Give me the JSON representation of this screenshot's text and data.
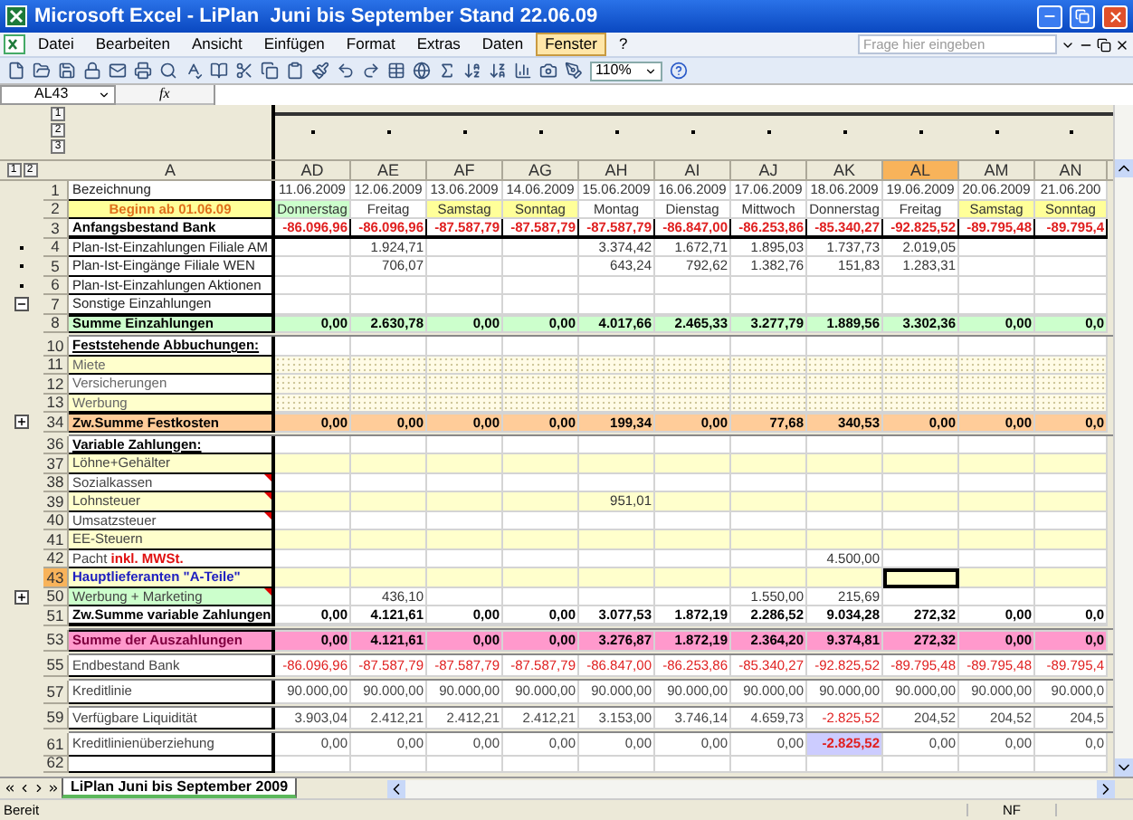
{
  "window": {
    "title": "Microsoft Excel - LiPlan  Juni bis September Stand 22.06.09"
  },
  "menu": [
    {
      "label": "Datei",
      "selected": false
    },
    {
      "label": "Bearbeiten",
      "selected": false
    },
    {
      "label": "Ansicht",
      "selected": false
    },
    {
      "label": "Einfügen",
      "selected": false
    },
    {
      "label": "Format",
      "selected": false
    },
    {
      "label": "Extras",
      "selected": false
    },
    {
      "label": "Daten",
      "selected": false
    },
    {
      "label": "Fenster",
      "selected": true
    },
    {
      "label": "?",
      "selected": false
    }
  ],
  "help_search": {
    "placeholder": "Frage hier eingeben"
  },
  "toolbar": {
    "zoom": "110%"
  },
  "formula_bar": {
    "name_box": "AL43",
    "fx": "fx"
  },
  "outline": {
    "column_levels": [
      "1",
      "2",
      "3"
    ],
    "row_levels": [
      "1",
      "2"
    ]
  },
  "first_column": "A",
  "columns": [
    {
      "letter": "AD",
      "first_day": true,
      "weekend": false,
      "selected": false
    },
    {
      "letter": "AE",
      "first_day": false,
      "weekend": false,
      "selected": false
    },
    {
      "letter": "AF",
      "first_day": false,
      "weekend": true,
      "selected": false
    },
    {
      "letter": "AG",
      "first_day": false,
      "weekend": true,
      "selected": false
    },
    {
      "letter": "AH",
      "first_day": false,
      "weekend": false,
      "selected": false
    },
    {
      "letter": "AI",
      "first_day": false,
      "weekend": false,
      "selected": false
    },
    {
      "letter": "AJ",
      "first_day": false,
      "weekend": false,
      "selected": false
    },
    {
      "letter": "AK",
      "first_day": false,
      "weekend": false,
      "selected": false
    },
    {
      "letter": "AL",
      "first_day": false,
      "weekend": false,
      "selected": true
    },
    {
      "letter": "AM",
      "first_day": false,
      "weekend": true,
      "selected": false
    },
    {
      "letter": "AN",
      "first_day": false,
      "weekend": true,
      "selected": false
    }
  ],
  "rows": [
    {
      "number": "1",
      "kind": "dates",
      "label": "Bezeichnung",
      "selected": false,
      "comment": false,
      "values": [
        "11.06.2009",
        "12.06.2009",
        "13.06.2009",
        "14.06.2009",
        "15.06.2009",
        "16.06.2009",
        "17.06.2009",
        "18.06.2009",
        "19.06.2009",
        "20.06.2009",
        "21.06.200"
      ]
    },
    {
      "number": "2",
      "kind": "days",
      "label": "Beginn ab 01.06.09",
      "selected": false,
      "comment": false,
      "values": [
        "Donnerstag",
        "Freitag",
        "Samstag",
        "Sonntag",
        "Montag",
        "Dienstag",
        "Mittwoch",
        "Donnerstag",
        "Freitag",
        "Samstag",
        "Sonntag"
      ]
    },
    {
      "number": "3",
      "kind": "balance",
      "label": "Anfangsbestand Bank",
      "selected": false,
      "comment": false,
      "values": [
        "-86.096,96",
        "-86.096,96",
        "-87.587,79",
        "-87.587,79",
        "-87.587,79",
        "-86.847,00",
        "-86.253,86",
        "-85.340,27",
        "-92.825,52",
        "-89.795,48",
        "-89.795,4"
      ],
      "negative": [
        true,
        true,
        true,
        true,
        true,
        true,
        true,
        true,
        true,
        true,
        true
      ]
    },
    {
      "number": "4",
      "kind": "entry",
      "outline": {
        "kind": "dot"
      },
      "label": "Plan-Ist-Einzahlungen Filiale AM",
      "selected": false,
      "comment": false,
      "values": {
        "1": "1.924,71",
        "4": "3.374,42",
        "5": "1.672,71",
        "6": "1.895,03",
        "7": "1.737,73",
        "8": "2.019,05"
      }
    },
    {
      "number": "5",
      "kind": "entry",
      "outline": {
        "kind": "dot"
      },
      "label": "Plan-Ist-Eingänge Filiale WEN",
      "selected": false,
      "comment": false,
      "values": {
        "1": "706,07",
        "4": "643,24",
        "5": "792,62",
        "6": "1.382,76",
        "7": "151,83",
        "8": "1.283,31"
      }
    },
    {
      "number": "6",
      "kind": "entry",
      "outline": {
        "kind": "dot"
      },
      "label": "Plan-Ist-Einzahlungen  Aktionen",
      "selected": false,
      "comment": false
    },
    {
      "number": "7",
      "kind": "entry",
      "outline": {
        "kind": "collapse"
      },
      "label": "Sonstige Einzahlungen",
      "selected": false,
      "comment": false
    },
    {
      "number": "8",
      "kind": "sum_green",
      "label": "Summe Einzahlungen",
      "selected": false,
      "comment": false,
      "values": [
        "0,00",
        "2.630,78",
        "0,00",
        "0,00",
        "4.017,66",
        "2.465,33",
        "3.277,79",
        "1.889,56",
        "3.302,36",
        "0,00",
        "0,0"
      ]
    },
    {
      "number": "10",
      "kind": "section",
      "gap_before": true,
      "label": "Feststehende Abbuchungen:",
      "selected": false,
      "comment": false
    },
    {
      "number": "11",
      "kind": "fixed",
      "band": {
        "kind": "yellow"
      },
      "label": "Miete",
      "selected": false,
      "comment": false
    },
    {
      "number": "12",
      "kind": "fixed",
      "band": {
        "kind": "none"
      },
      "label": "Versicherungen",
      "selected": false,
      "comment": false
    },
    {
      "number": "13",
      "kind": "fixed",
      "band": {
        "kind": "yellow"
      },
      "label": "Werbung",
      "selected": false,
      "comment": false
    },
    {
      "number": "34",
      "kind": "sum_orange",
      "outline": {
        "kind": "expand"
      },
      "label": "Zw.Summe Festkosten",
      "selected": false,
      "comment": false,
      "values": [
        "0,00",
        "0,00",
        "0,00",
        "0,00",
        "199,34",
        "0,00",
        "77,68",
        "340,53",
        "0,00",
        "0,00",
        "0,0"
      ]
    },
    {
      "number": "36",
      "kind": "section",
      "gap_before": true,
      "label": "Variable Zahlungen:",
      "selected": false,
      "comment": false
    },
    {
      "number": "37",
      "kind": "variable",
      "band": {
        "kind": "yellow"
      },
      "label": "Löhne+Gehälter",
      "selected": false,
      "comment": false
    },
    {
      "number": "38",
      "kind": "variable",
      "band": {
        "kind": "none"
      },
      "label": "Sozialkassen",
      "selected": false,
      "comment": true
    },
    {
      "number": "39",
      "kind": "variable",
      "band": {
        "kind": "yellow"
      },
      "label": "Lohnsteuer",
      "selected": false,
      "comment": true,
      "values": {
        "4": "951,01"
      }
    },
    {
      "number": "40",
      "kind": "variable",
      "band": {
        "kind": "none"
      },
      "label": "Umsatzsteuer",
      "selected": false,
      "comment": true
    },
    {
      "number": "41",
      "kind": "variable",
      "band": {
        "kind": "yellow"
      },
      "label": "EE-Steuern",
      "selected": false,
      "comment": false
    },
    {
      "number": "42",
      "kind": "variable",
      "band": {
        "kind": "none"
      },
      "label": "Pacht",
      "label_note": "inkl. MWSt.",
      "selected": false,
      "comment": false,
      "values": {
        "7": "4.500,00"
      }
    },
    {
      "number": "43",
      "kind": "supplier",
      "band": {
        "kind": "yellow"
      },
      "label": "Hauptlieferanten \"A-Teile\"",
      "selected": true,
      "comment": false
    },
    {
      "number": "50",
      "kind": "variable",
      "band": {
        "kind": "green"
      },
      "outline": {
        "kind": "expand"
      },
      "label": "Werbung + Marketing",
      "selected": false,
      "comment": true,
      "values": {
        "1": "436,10",
        "6": "1.550,00",
        "7": "215,69"
      }
    },
    {
      "number": "51",
      "kind": "sum_variable",
      "label": "Zw.Summe variable Zahlungen",
      "selected": false,
      "comment": false,
      "values": [
        "0,00",
        "4.121,61",
        "0,00",
        "0,00",
        "3.077,53",
        "1.872,19",
        "2.286,52",
        "9.034,28",
        "272,32",
        "0,00",
        "0,0"
      ]
    },
    {
      "number": "53",
      "kind": "sum_pink",
      "gap_before": true,
      "label": "Summe der Auszahlungen",
      "selected": false,
      "comment": false,
      "values": [
        "0,00",
        "4.121,61",
        "0,00",
        "0,00",
        "3.276,87",
        "1.872,19",
        "2.364,20",
        "9.374,81",
        "272,32",
        "0,00",
        "0,0"
      ]
    },
    {
      "number": "55",
      "kind": "bottom",
      "gap_before": true,
      "label": "Endbestand Bank",
      "selected": false,
      "comment": false,
      "values": [
        "-86.096,96",
        "-87.587,79",
        "-87.587,79",
        "-87.587,79",
        "-86.847,00",
        "-86.253,86",
        "-85.340,27",
        "-92.825,52",
        "-89.795,48",
        "-89.795,48",
        "-89.795,4"
      ],
      "negative": [
        true,
        true,
        true,
        true,
        true,
        true,
        true,
        true,
        true,
        true,
        true
      ]
    },
    {
      "number": "57",
      "kind": "bottom",
      "gap_before": true,
      "label": "Kreditlinie",
      "selected": false,
      "comment": false,
      "values": [
        "90.000,00",
        "90.000,00",
        "90.000,00",
        "90.000,00",
        "90.000,00",
        "90.000,00",
        "90.000,00",
        "90.000,00",
        "90.000,00",
        "90.000,00",
        "90.000,0"
      ]
    },
    {
      "number": "59",
      "kind": "bottom",
      "gap_before": true,
      "label": "Verfügbare Liquidität",
      "selected": false,
      "comment": false,
      "values": [
        "3.903,04",
        "2.412,21",
        "2.412,21",
        "2.412,21",
        "3.153,00",
        "3.746,14",
        "4.659,73",
        "-2.825,52",
        "204,52",
        "204,52",
        "204,5"
      ],
      "negative": [
        false,
        false,
        false,
        false,
        false,
        false,
        false,
        true,
        false,
        false,
        false
      ]
    },
    {
      "number": "61",
      "kind": "bottom",
      "gap_before": true,
      "label": "Kreditlinienüberziehung",
      "selected": false,
      "comment": false,
      "values": [
        "0,00",
        "0,00",
        "0,00",
        "0,00",
        "0,00",
        "0,00",
        "0,00",
        "-2.825,52",
        "0,00",
        "0,00",
        "0,0"
      ],
      "negative": [
        false,
        false,
        false,
        false,
        false,
        false,
        false,
        true,
        false,
        false,
        false
      ],
      "highlight": [
        false,
        false,
        false,
        false,
        false,
        false,
        false,
        true,
        false,
        false,
        false
      ]
    },
    {
      "number": "62",
      "kind": "empty",
      "selected": false,
      "comment": false
    }
  ],
  "sheet_tabs": [
    {
      "label": "LiPlan Juni bis September 2009",
      "selected": true
    }
  ],
  "status_bar": {
    "left": "Bereit",
    "right": "NF"
  }
}
